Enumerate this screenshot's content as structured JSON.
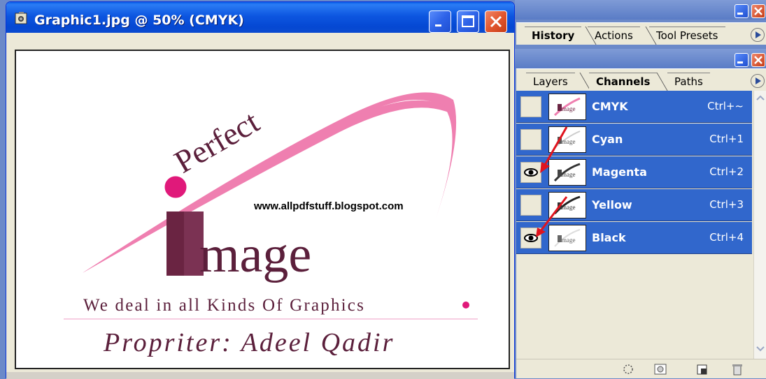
{
  "document_window": {
    "title": "Graphic1.jpg @ 50% (CMYK)",
    "watermark": "www.allpdfstuff.blogspot.com",
    "logo": {
      "word_perfect": "Perfect",
      "word_image": "mage",
      "tagline": "We deal in all Kinds Of Graphics",
      "proprietor": "Propriter: Adeel Qadir",
      "colors": {
        "pink": "#ef7fb0",
        "dot": "#e0197a",
        "maroon": "#6a2442",
        "text": "#5b1f3b"
      }
    }
  },
  "history_panel": {
    "tabs": [
      {
        "label": "History",
        "active": true
      },
      {
        "label": "Actions",
        "active": false
      },
      {
        "label": "Tool Presets",
        "active": false
      }
    ]
  },
  "channels_panel": {
    "tabs": [
      {
        "label": "Layers",
        "active": false
      },
      {
        "label": "Channels",
        "active": true
      },
      {
        "label": "Paths",
        "active": false
      }
    ],
    "channels": [
      {
        "name": "CMYK",
        "shortcut": "Ctrl+~",
        "visible": false
      },
      {
        "name": "Cyan",
        "shortcut": "Ctrl+1",
        "visible": false
      },
      {
        "name": "Magenta",
        "shortcut": "Ctrl+2",
        "visible": true
      },
      {
        "name": "Yellow",
        "shortcut": "Ctrl+3",
        "visible": false
      },
      {
        "name": "Black",
        "shortcut": "Ctrl+4",
        "visible": true
      }
    ],
    "footer_buttons": [
      "load-selection-icon",
      "save-selection-icon",
      "new-channel-icon",
      "trash-icon"
    ]
  },
  "colors": {
    "titlebar": "#0a4bd0",
    "selection": "#3167cc",
    "panel_bg": "#ece9d8",
    "annotation_arrow": "#e0141e"
  }
}
